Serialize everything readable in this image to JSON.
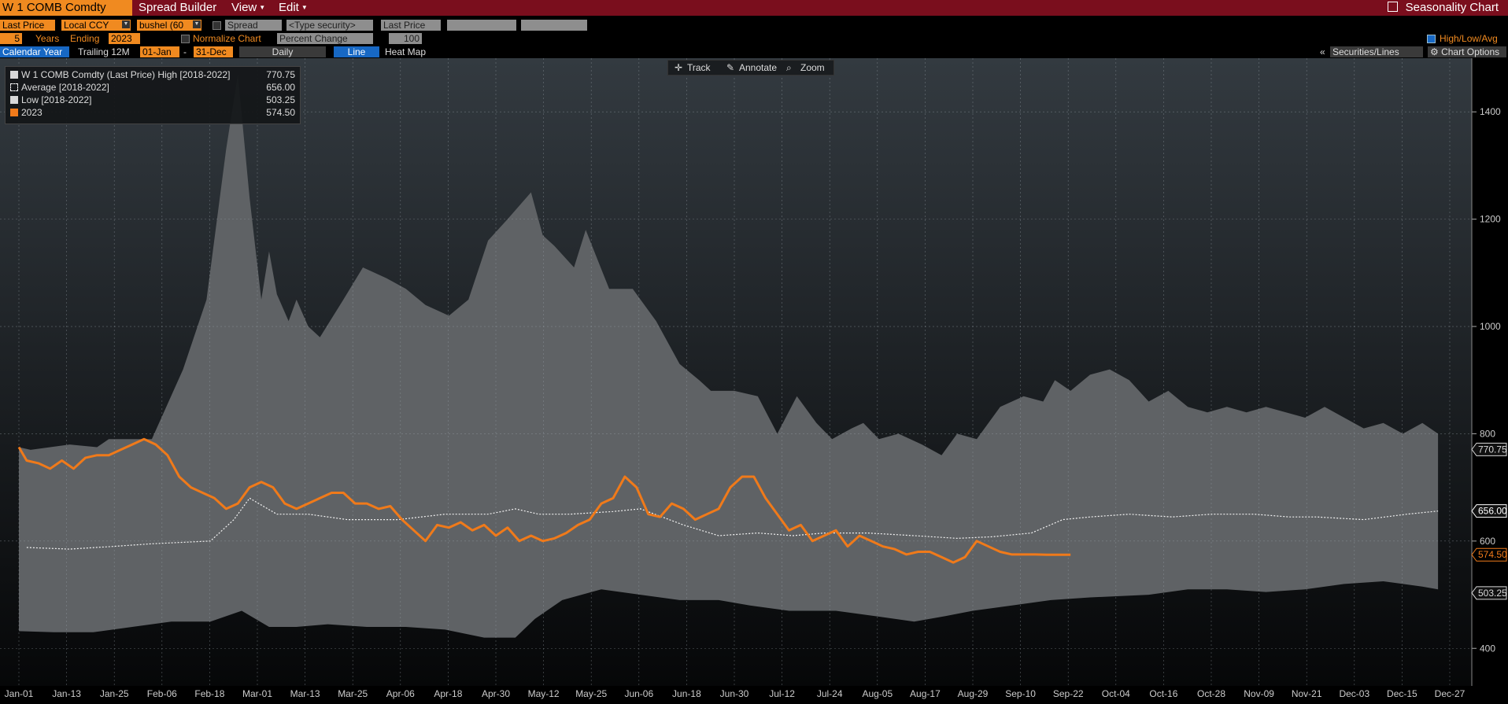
{
  "header": {
    "ticker": "W 1 COMB Comdty",
    "menu": [
      "Spread Builder",
      "View",
      "Edit"
    ],
    "app_title": "Seasonality Chart"
  },
  "controls_row1": {
    "price_field": "Last Price",
    "currency": "Local CCY",
    "unit": "bushel (60",
    "spread": "Spread",
    "type_security": "<Type security>",
    "second_price": "Last Price"
  },
  "controls_row2": {
    "years": "5",
    "years_label": "Years",
    "ending_label": "Ending",
    "ending_year": "2023",
    "normalize_label": "Normalize Chart",
    "normalize_mode": "Percent Change",
    "normalize_value": "100",
    "high_low_avg": "High/Low/Avg"
  },
  "controls_row3": {
    "calendar_year": "Calendar Year",
    "trailing": "Trailing 12M",
    "start": "01-Jan",
    "dash": "-",
    "end": "31-Dec",
    "frequency": "Daily",
    "line": "Line",
    "heat_map": "Heat Map",
    "securities_lines": "Securities/Lines",
    "chart_options": "Chart Options"
  },
  "toolbox": [
    "Track",
    "Annotate",
    "Zoom"
  ],
  "legend": [
    {
      "label": "W 1 COMB Comdty (Last Price) High [2018-2022]",
      "value": "770.75",
      "color": "#d8d8d8"
    },
    {
      "label": "Average  [2018-2022]",
      "value": "656.00",
      "color": "#ffffff"
    },
    {
      "label": "Low  [2018-2022]",
      "value": "503.25",
      "color": "#d8d8d8"
    },
    {
      "label": "2023",
      "value": "574.50",
      "color": "#f07a1a"
    }
  ],
  "chart_data": {
    "type": "area",
    "x_ticks": [
      "Jan-01",
      "Jan-13",
      "Jan-25",
      "Feb-06",
      "Feb-18",
      "Mar-01",
      "Mar-13",
      "Mar-25",
      "Apr-06",
      "Apr-18",
      "Apr-30",
      "May-12",
      "May-25",
      "Jun-06",
      "Jun-18",
      "Jun-30",
      "Jul-12",
      "Jul-24",
      "Aug-05",
      "Aug-17",
      "Aug-29",
      "Sep-10",
      "Sep-22",
      "Oct-04",
      "Oct-16",
      "Oct-28",
      "Nov-09",
      "Nov-21",
      "Dec-03",
      "Dec-15",
      "Dec-27"
    ],
    "y_ticks": [
      400,
      600,
      800,
      1000,
      1200,
      1400
    ],
    "ylim": [
      330,
      1500
    ],
    "xlim": [
      1,
      367
    ],
    "grid": true,
    "legend_position": "top-left",
    "colors": {
      "band": "#5f6265",
      "avg": "#f2f2f2",
      "current": "#f07a1a",
      "background_top": "#333a40",
      "background_bottom": "#060708"
    },
    "high": {
      "x": [
        1,
        4,
        14,
        21,
        24,
        32,
        35,
        43,
        49,
        54,
        57,
        60,
        63,
        65,
        67,
        70,
        72,
        75,
        78,
        84,
        89,
        95,
        100,
        105,
        111,
        116,
        121,
        126,
        132,
        135,
        138,
        143,
        146,
        152,
        158,
        164,
        170,
        175,
        178,
        184,
        190,
        195,
        200,
        205,
        209,
        214,
        217,
        221,
        226,
        232,
        237,
        241,
        246,
        252,
        258,
        263,
        266,
        270,
        275,
        280,
        285,
        290,
        295,
        300,
        305,
        310,
        315,
        320,
        330,
        335,
        340,
        345,
        350,
        355,
        360,
        364
      ],
      "values": [
        775,
        770,
        780,
        775,
        790,
        790,
        790,
        920,
        1050,
        1330,
        1470,
        1240,
        1050,
        1140,
        1060,
        1010,
        1050,
        1000,
        980,
        1050,
        1110,
        1090,
        1070,
        1040,
        1020,
        1050,
        1160,
        1200,
        1250,
        1170,
        1150,
        1110,
        1180,
        1070,
        1070,
        1010,
        930,
        900,
        880,
        880,
        870,
        800,
        870,
        820,
        790,
        810,
        820,
        790,
        800,
        780,
        760,
        800,
        790,
        850,
        870,
        860,
        900,
        880,
        910,
        920,
        900,
        860,
        880,
        850,
        840,
        850,
        840,
        850,
        830,
        850,
        830,
        810,
        820,
        800,
        820,
        800
      ]
    },
    "average": {
      "x": [
        3,
        14,
        25,
        35,
        50,
        56,
        60,
        67,
        75,
        85,
        98,
        110,
        121,
        128,
        134,
        142,
        153,
        160,
        171,
        180,
        190,
        199,
        207,
        218,
        230,
        241,
        250,
        260,
        268,
        275,
        285,
        296,
        306,
        317,
        326,
        333,
        345,
        356,
        364
      ],
      "values": [
        588,
        585,
        590,
        595,
        600,
        640,
        680,
        650,
        650,
        640,
        640,
        650,
        650,
        660,
        650,
        650,
        655,
        660,
        630,
        610,
        615,
        610,
        615,
        615,
        610,
        605,
        608,
        615,
        640,
        645,
        650,
        645,
        650,
        650,
        645,
        645,
        640,
        650,
        656
      ]
    },
    "low": {
      "x": [
        1,
        10,
        20,
        30,
        40,
        50,
        58,
        65,
        72,
        80,
        90,
        100,
        110,
        120,
        128,
        133,
        140,
        150,
        160,
        170,
        180,
        188,
        198,
        210,
        220,
        230,
        238,
        245,
        255,
        265,
        275,
        290,
        300,
        310,
        320,
        330,
        340,
        350,
        360,
        364
      ],
      "values": [
        432,
        430,
        430,
        440,
        450,
        450,
        470,
        440,
        440,
        445,
        440,
        440,
        435,
        420,
        420,
        455,
        490,
        510,
        500,
        490,
        490,
        480,
        470,
        470,
        460,
        450,
        460,
        470,
        480,
        490,
        495,
        500,
        510,
        510,
        505,
        510,
        520,
        525,
        515,
        510
      ]
    },
    "current": {
      "name": "2023",
      "x": [
        1,
        3,
        6,
        9,
        12,
        15,
        18,
        21,
        24,
        27,
        30,
        33,
        36,
        39,
        42,
        45,
        48,
        51,
        54,
        57,
        60,
        63,
        66,
        69,
        72,
        75,
        78,
        81,
        84,
        87,
        90,
        93,
        96,
        99,
        102,
        105,
        108,
        111,
        114,
        117,
        120,
        123,
        126,
        129,
        132,
        135,
        138,
        141,
        144,
        147,
        150,
        153,
        156,
        159,
        162,
        165,
        168,
        171,
        174,
        177,
        180,
        183,
        186,
        189,
        192,
        195,
        198,
        201,
        204,
        207,
        210,
        213,
        216,
        219,
        222,
        225,
        228,
        231,
        234,
        237,
        240,
        243,
        246,
        249,
        252,
        255,
        258,
        261,
        264,
        267,
        270
      ],
      "values": [
        775,
        750,
        745,
        735,
        750,
        735,
        755,
        760,
        760,
        770,
        780,
        790,
        780,
        760,
        720,
        700,
        690,
        680,
        660,
        670,
        700,
        710,
        700,
        670,
        660,
        670,
        680,
        690,
        690,
        670,
        670,
        660,
        665,
        640,
        620,
        600,
        630,
        625,
        635,
        620,
        630,
        610,
        625,
        600,
        610,
        600,
        605,
        615,
        630,
        640,
        670,
        680,
        720,
        700,
        650,
        645,
        670,
        660,
        640,
        650,
        660,
        700,
        720,
        720,
        680,
        650,
        620,
        630,
        600,
        610,
        620,
        590,
        610,
        600,
        590,
        585,
        575,
        580,
        580,
        570,
        560,
        570,
        600,
        590,
        580,
        575,
        575,
        575,
        574.5,
        574.5,
        574.5
      ]
    },
    "value_labels": [
      {
        "text": "770.75",
        "value": 770.75,
        "color": "#d8d8d8"
      },
      {
        "text": "656.00",
        "value": 656.0,
        "color": "#ffffff"
      },
      {
        "text": "574.50",
        "value": 574.5,
        "color": "#f07a1a"
      },
      {
        "text": "503.25",
        "value": 503.25,
        "color": "#d8d8d8"
      }
    ]
  }
}
